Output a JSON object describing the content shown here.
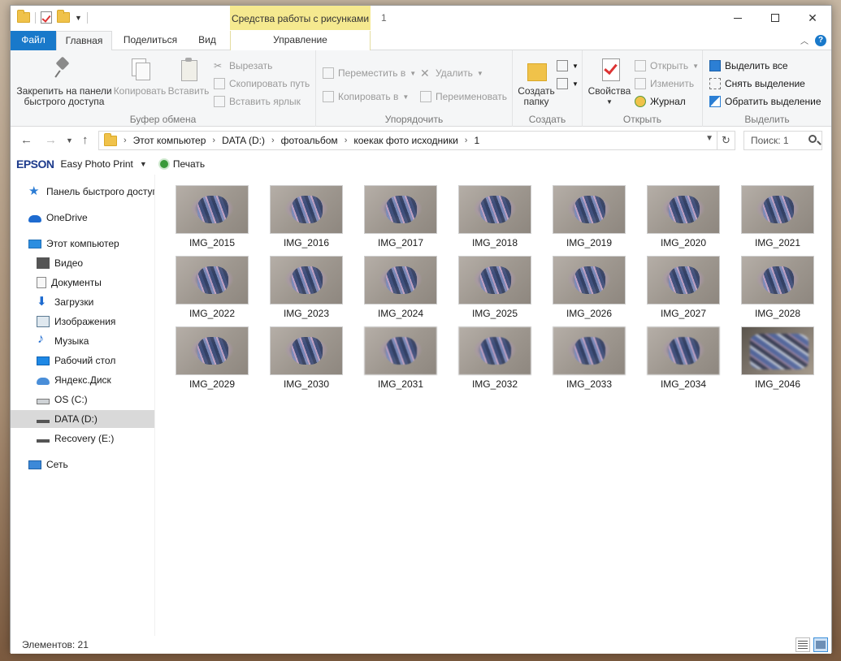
{
  "window": {
    "title": "1",
    "context_tab_group": "Средства работы с рисунками"
  },
  "ribbon_tabs": {
    "file": "Файл",
    "home": "Главная",
    "share": "Поделиться",
    "view": "Вид",
    "manage": "Управление"
  },
  "ribbon": {
    "clipboard": {
      "label": "Буфер обмена",
      "pin": "Закрепить на панели быстрого доступа",
      "pin_line1": "Закрепить на панели",
      "pin_line2": "быстрого доступа",
      "copy": "Копировать",
      "paste": "Вставить",
      "cut": "Вырезать",
      "copy_path": "Скопировать путь",
      "paste_shortcut": "Вставить ярлык"
    },
    "organize": {
      "label": "Упорядочить",
      "move_to": "Переместить в",
      "copy_to": "Копировать в",
      "delete": "Удалить",
      "rename": "Переименовать"
    },
    "new": {
      "label": "Создать",
      "new_folder_line1": "Создать",
      "new_folder_line2": "папку"
    },
    "open": {
      "label": "Открыть",
      "properties": "Свойства",
      "open": "Открыть",
      "edit": "Изменить",
      "history": "Журнал"
    },
    "select": {
      "label": "Выделить",
      "select_all": "Выделить все",
      "select_none": "Снять выделение",
      "invert": "Обратить выделение"
    }
  },
  "address": {
    "crumbs": [
      "Этот компьютер",
      "DATA (D:)",
      "фотоальбом",
      "коекак фото исходники",
      "1"
    ],
    "search_placeholder": "Поиск: 1"
  },
  "epson": {
    "logo": "EPSON",
    "app": "Easy Photo Print",
    "print": "Печать"
  },
  "sidebar": {
    "items": [
      {
        "label": "Панель быстрого доступа",
        "icon": "star-icon"
      },
      {
        "label": "OneDrive",
        "icon": "cloud-icon"
      },
      {
        "label": "Этот компьютер",
        "icon": "computer-icon"
      },
      {
        "label": "Видео",
        "icon": "video-icon"
      },
      {
        "label": "Документы",
        "icon": "document-icon"
      },
      {
        "label": "Загрузки",
        "icon": "download-icon"
      },
      {
        "label": "Изображения",
        "icon": "image-icon"
      },
      {
        "label": "Музыка",
        "icon": "music-icon"
      },
      {
        "label": "Рабочий стол",
        "icon": "desktop-icon"
      },
      {
        "label": "Яндекс.Диск",
        "icon": "cloud-icon"
      },
      {
        "label": "OS (C:)",
        "icon": "drive-icon"
      },
      {
        "label": "DATA (D:)",
        "icon": "drive-icon"
      },
      {
        "label": "Recovery (E:)",
        "icon": "drive-icon"
      },
      {
        "label": "Сеть",
        "icon": "network-icon"
      }
    ]
  },
  "files": [
    "IMG_2015",
    "IMG_2016",
    "IMG_2017",
    "IMG_2018",
    "IMG_2019",
    "IMG_2020",
    "IMG_2021",
    "IMG_2022",
    "IMG_2023",
    "IMG_2024",
    "IMG_2025",
    "IMG_2026",
    "IMG_2027",
    "IMG_2028",
    "IMG_2029",
    "IMG_2030",
    "IMG_2031",
    "IMG_2032",
    "IMG_2033",
    "IMG_2034",
    "IMG_2046"
  ],
  "status": {
    "items_count": "Элементов: 21"
  }
}
